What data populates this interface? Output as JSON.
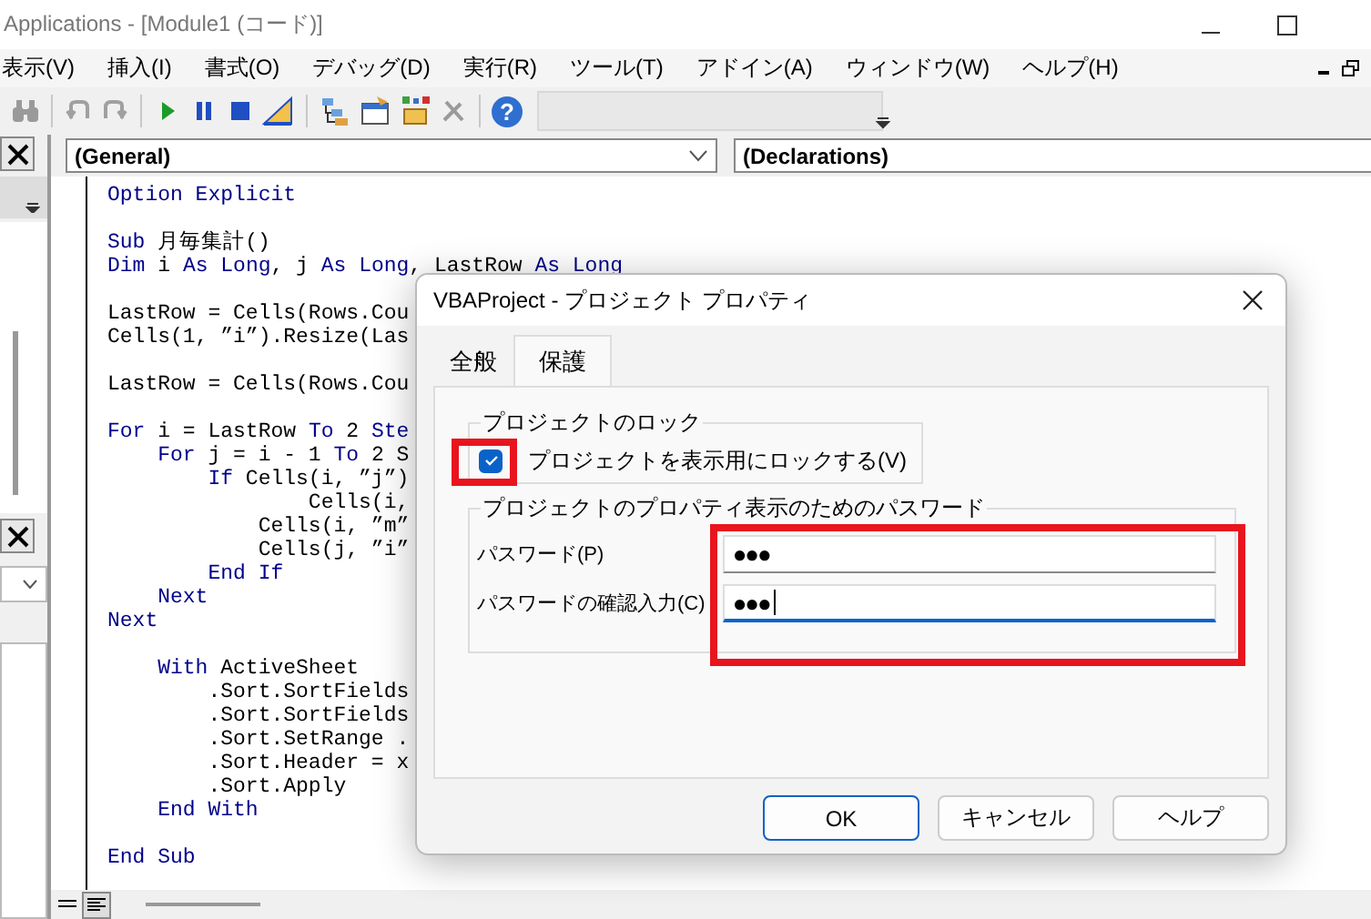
{
  "window": {
    "title": "Applications - [Module1 (コード)]"
  },
  "menu": [
    "表示(V)",
    "挿入(I)",
    "書式(O)",
    "デバッグ(D)",
    "実行(R)",
    "ツール(T)",
    "アドイン(A)",
    "ウィンドウ(W)",
    "ヘルプ(H)"
  ],
  "toolbar": [
    {
      "kind": "find",
      "disabled": true
    },
    {
      "kind": "sep"
    },
    {
      "kind": "undo",
      "disabled": true
    },
    {
      "kind": "redo",
      "disabled": true
    },
    {
      "kind": "sep"
    },
    {
      "kind": "run",
      "disabled": false
    },
    {
      "kind": "pause",
      "disabled": false
    },
    {
      "kind": "stop",
      "disabled": false
    },
    {
      "kind": "design",
      "disabled": false
    },
    {
      "kind": "sep"
    },
    {
      "kind": "explorer",
      "disabled": false
    },
    {
      "kind": "properties",
      "disabled": false
    },
    {
      "kind": "browser",
      "disabled": false
    },
    {
      "kind": "toolbox",
      "disabled": true
    },
    {
      "kind": "sep"
    },
    {
      "kind": "help",
      "disabled": false,
      "glyph": "?"
    }
  ],
  "code_window": {
    "object": "(General)",
    "procedure": "(Declarations)",
    "lines": [
      {
        "kind": "code",
        "tokens": [
          {
            "kind": "kw",
            "text": "Option Explicit"
          }
        ]
      },
      {
        "kind": "blank"
      },
      {
        "kind": "code",
        "tokens": [
          {
            "kind": "kw",
            "text": "Sub"
          },
          {
            "kind": "plain",
            "text": " 月毎集計()"
          }
        ]
      },
      {
        "kind": "code",
        "tokens": [
          {
            "kind": "kw",
            "text": "Dim"
          },
          {
            "kind": "plain",
            "text": " i "
          },
          {
            "kind": "kw",
            "text": "As Long"
          },
          {
            "kind": "plain",
            "text": ", j "
          },
          {
            "kind": "kw",
            "text": "As Long"
          },
          {
            "kind": "plain",
            "text": ", LastRow "
          },
          {
            "kind": "kw",
            "text": "As Long"
          }
        ]
      },
      {
        "kind": "blank"
      },
      {
        "kind": "code",
        "tokens": [
          {
            "kind": "plain",
            "text": "LastRow = Cells(Rows.Cou"
          }
        ]
      },
      {
        "kind": "code",
        "tokens": [
          {
            "kind": "plain",
            "text": "Cells(1, ”i”).Resize(Las"
          }
        ]
      },
      {
        "kind": "blank"
      },
      {
        "kind": "code",
        "tokens": [
          {
            "kind": "plain",
            "text": "LastRow = Cells(Rows.Cou"
          }
        ]
      },
      {
        "kind": "blank"
      },
      {
        "kind": "code",
        "tokens": [
          {
            "kind": "kw",
            "text": "For"
          },
          {
            "kind": "plain",
            "text": " i = LastRow "
          },
          {
            "kind": "kw",
            "text": "To"
          },
          {
            "kind": "plain",
            "text": " 2 "
          },
          {
            "kind": "kw",
            "text": "Ste"
          }
        ]
      },
      {
        "kind": "code",
        "tokens": [
          {
            "kind": "kw",
            "text": "    For"
          },
          {
            "kind": "plain",
            "text": " j = i - 1 "
          },
          {
            "kind": "kw",
            "text": "To"
          },
          {
            "kind": "plain",
            "text": " 2 S"
          }
        ]
      },
      {
        "kind": "code",
        "tokens": [
          {
            "kind": "kw",
            "text": "        If"
          },
          {
            "kind": "plain",
            "text": " Cells(i, ”j”)"
          }
        ]
      },
      {
        "kind": "code",
        "tokens": [
          {
            "kind": "plain",
            "text": "                Cells(i,"
          }
        ]
      },
      {
        "kind": "code",
        "tokens": [
          {
            "kind": "plain",
            "text": "            Cells(i, ”m”"
          }
        ]
      },
      {
        "kind": "code",
        "tokens": [
          {
            "kind": "plain",
            "text": "            Cells(j, ”i”"
          }
        ]
      },
      {
        "kind": "code",
        "tokens": [
          {
            "kind": "kw",
            "text": "        End If"
          }
        ]
      },
      {
        "kind": "code",
        "tokens": [
          {
            "kind": "kw",
            "text": "    Next"
          }
        ]
      },
      {
        "kind": "code",
        "tokens": [
          {
            "kind": "kw",
            "text": "Next"
          }
        ]
      },
      {
        "kind": "blank"
      },
      {
        "kind": "code",
        "tokens": [
          {
            "kind": "kw",
            "text": "    With"
          },
          {
            "kind": "plain",
            "text": " ActiveSheet"
          }
        ]
      },
      {
        "kind": "code",
        "tokens": [
          {
            "kind": "plain",
            "text": "        .Sort.SortFields"
          }
        ]
      },
      {
        "kind": "code",
        "tokens": [
          {
            "kind": "plain",
            "text": "        .Sort.SortFields"
          }
        ]
      },
      {
        "kind": "code",
        "tokens": [
          {
            "kind": "plain",
            "text": "        .Sort.SetRange ."
          }
        ]
      },
      {
        "kind": "code",
        "tokens": [
          {
            "kind": "plain",
            "text": "        .Sort.Header = x"
          }
        ]
      },
      {
        "kind": "code",
        "tokens": [
          {
            "kind": "plain",
            "text": "        .Sort.Apply"
          }
        ]
      },
      {
        "kind": "code",
        "tokens": [
          {
            "kind": "kw",
            "text": "    End With"
          }
        ]
      },
      {
        "kind": "blank"
      },
      {
        "kind": "code",
        "tokens": [
          {
            "kind": "kw",
            "text": "End Sub"
          }
        ]
      }
    ]
  },
  "dialog": {
    "title": "VBAProject - プロジェクト プロパティ",
    "tabs": [
      {
        "label": "全般",
        "selected": false
      },
      {
        "label": "保護",
        "selected": true
      }
    ],
    "lock_group": {
      "legend": "プロジェクトのロック",
      "checkbox": {
        "label": "プロジェクトを表示用にロックする(V)",
        "checked": true
      }
    },
    "password_group": {
      "legend": "プロジェクトのプロパティ表示のためのパスワード",
      "fields": [
        {
          "label": "パスワード(P)",
          "value": "●●●",
          "focused": false
        },
        {
          "label": "パスワードの確認入力(C)",
          "value": "●●●",
          "focused": true
        }
      ]
    },
    "buttons": [
      {
        "label": "OK",
        "default": true
      },
      {
        "label": "キャンセル",
        "default": false
      },
      {
        "label": "ヘルプ",
        "default": false
      }
    ]
  }
}
